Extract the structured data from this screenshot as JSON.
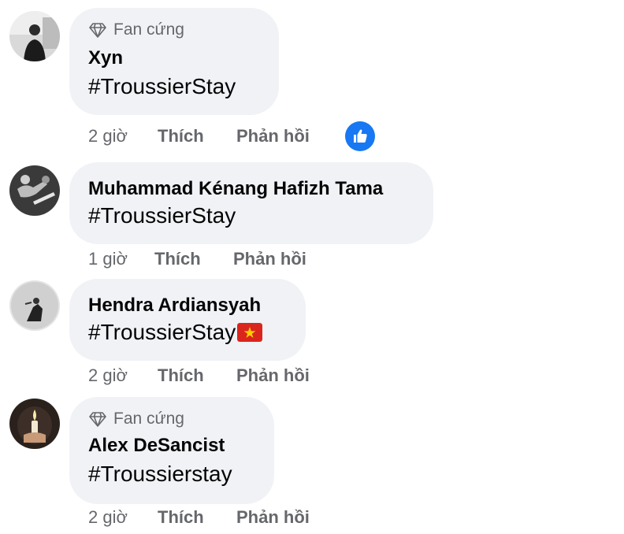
{
  "comments": [
    {
      "badge": "Fan cứng",
      "name": "Xyn",
      "text": "#TroussierStay",
      "time": "2 giờ",
      "like": "Thích",
      "reply": "Phản hồi",
      "reaction": "like-icon"
    },
    {
      "badge": "",
      "name": "Muhammad Kénang Hafizh Tama",
      "text": "#TroussierStay",
      "time": "1 giờ",
      "like": "Thích",
      "reply": "Phản hồi"
    },
    {
      "badge": "",
      "name": "Hendra Ardiansyah",
      "text": "#TroussierStay",
      "emoji": "vietnam-flag-icon",
      "time": "2 giờ",
      "like": "Thích",
      "reply": "Phản hồi"
    },
    {
      "badge": "Fan cứng",
      "name": "Alex DeSancist",
      "text": "#Troussierstay",
      "time": "2 giờ",
      "like": "Thích",
      "reply": "Phản hồi"
    }
  ],
  "colors": {
    "bubble": "#f0f2f5",
    "secondary_text": "#65676b",
    "primary_text": "#050505",
    "like_blue": "#1877f2"
  }
}
